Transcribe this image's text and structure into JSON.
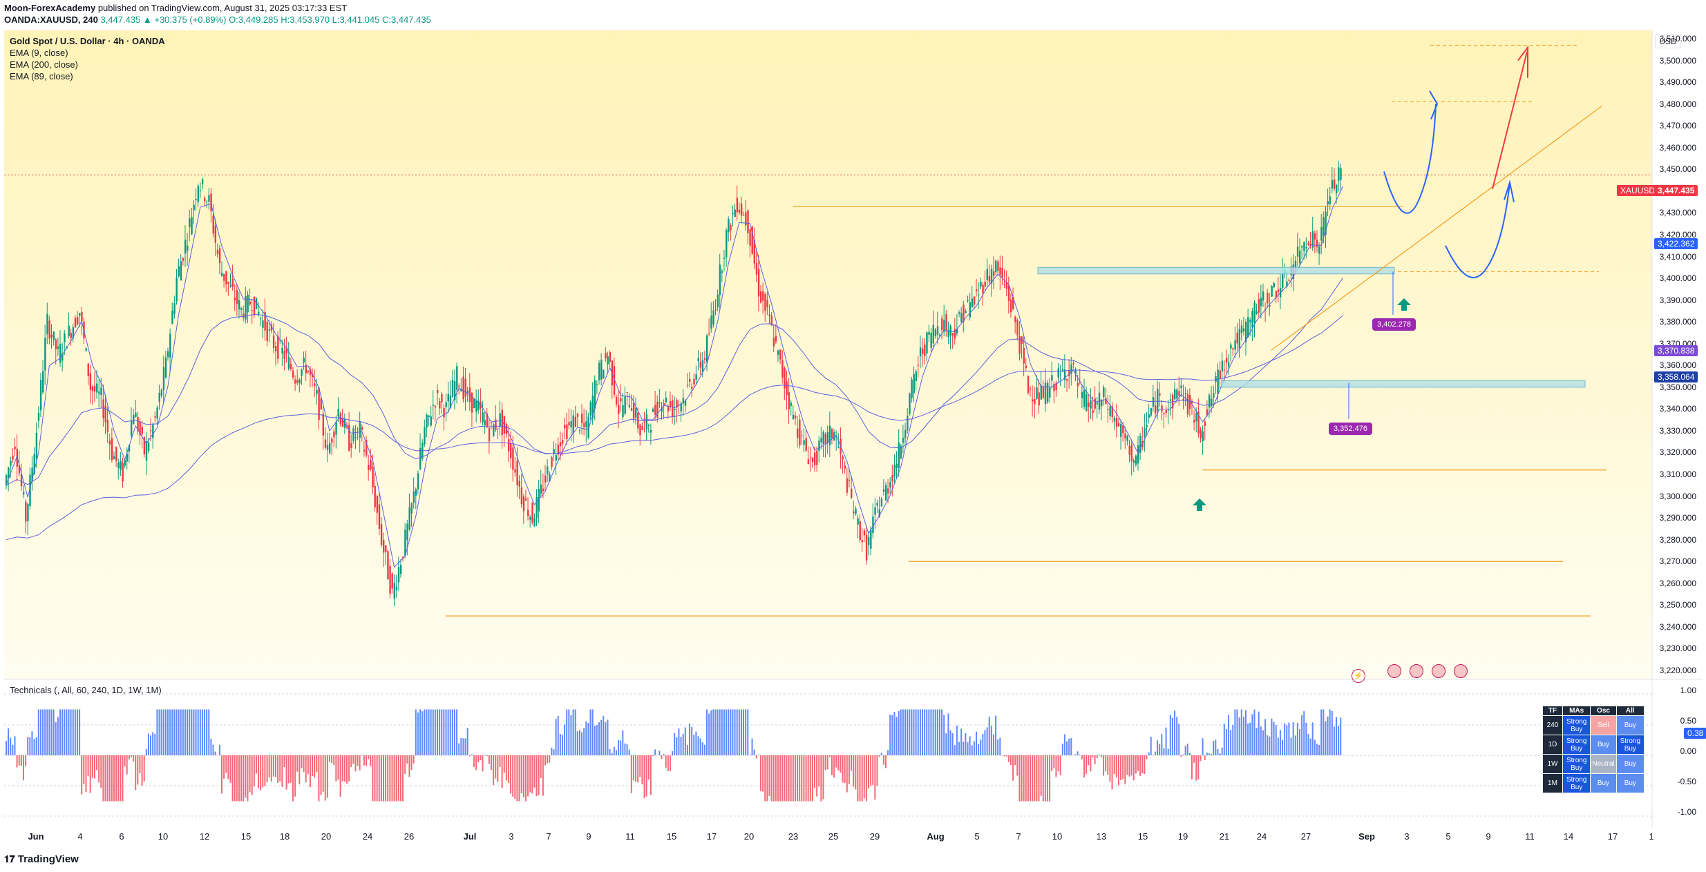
{
  "header": {
    "publisher": "Moon-ForexAcademy",
    "published_text": " published on TradingView.com, August 31, 2025 03:17:33 EST",
    "symbol": "OANDA:XAUUSD, 240",
    "change": "3,447.435 ▲ +30.375 (+0.89%)",
    "ohlc": "O:3,449.285  H:3,453.970  L:3,441.045  C:3,447.435"
  },
  "legend": {
    "title": "Gold Spot / U.S. Dollar · 4h · OANDA",
    "ema9": "EMA (9, close)",
    "ema200": "EMA (200, close)",
    "ema89": "EMA (89, close)"
  },
  "currency_button": "USD",
  "price_tags": {
    "symbol": "XAUUSD",
    "last": "3,447.435",
    "ema9": "3,422.362",
    "ema89": "3,370.838",
    "ema200": "3,358.064"
  },
  "annotations": {
    "label_1": "3,402.278",
    "label_2": "3,352.476"
  },
  "technicals": {
    "title": "Technicals (, All, 60, 240, 1D, 1W, 1M)",
    "value_tag": "0.38",
    "y_ticks": [
      "1.00",
      "0.50",
      "0.00",
      "-0.50",
      "-1.00"
    ],
    "table": {
      "headers": [
        "TF",
        "MAs",
        "Osc",
        "All"
      ],
      "rows": [
        [
          "240",
          "Strong Buy",
          "Sell",
          "Buy"
        ],
        [
          "1D",
          "Strong Buy",
          "Buy",
          "Strong Buy"
        ],
        [
          "1W",
          "Strong Buy",
          "Neutral",
          "Buy"
        ],
        [
          "1M",
          "Strong Buy",
          "Buy",
          "Buy"
        ]
      ]
    }
  },
  "footer_logo": "TradingView",
  "colors": {
    "bull": "#089981",
    "bear": "#f23645",
    "ema": "#5b5fe0",
    "orange": "#f59c1a",
    "blue_arrow": "#2962ff",
    "red_arrow": "#f23645",
    "zone": "#b2dfe6",
    "purple": "#9c27b0"
  },
  "chart_data": {
    "type": "candlestick",
    "symbol": "XAUUSD",
    "timeframe": "4h",
    "y_ticks": [
      3220,
      3230,
      3240,
      3250,
      3260,
      3270,
      3280,
      3290,
      3300,
      3310,
      3320,
      3330,
      3340,
      3350,
      3360,
      3370,
      3380,
      3390,
      3400,
      3410,
      3420,
      3430,
      3440,
      3450,
      3460,
      3470,
      3480,
      3490,
      3500,
      3510
    ],
    "y_tick_labels": [
      "3,220.000",
      "3,230.000",
      "3,240.000",
      "3,250.000",
      "3,260.000",
      "3,270.000",
      "3,280.000",
      "3,290.000",
      "3,300.000",
      "3,310.000",
      "3,320.000",
      "3,330.000",
      "3,340.000",
      "3,350.000",
      "3,360.000",
      "3,370.000",
      "3,380.000",
      "3,390.000",
      "3,400.000",
      "3,410.000",
      "3,420.000",
      "3,430.000",
      "3,440.000",
      "3,450.000",
      "3,460.000",
      "3,470.000",
      "3,480.000",
      "3,490.000",
      "3,500.000",
      "3,510.000"
    ],
    "x_labels": [
      "Jun",
      "4",
      "6",
      "10",
      "12",
      "15",
      "18",
      "20",
      "24",
      "26",
      "Jul",
      "3",
      "7",
      "9",
      "11",
      "15",
      "17",
      "20",
      "23",
      "25",
      "29",
      "Aug",
      "5",
      "7",
      "10",
      "13",
      "15",
      "19",
      "21",
      "24",
      "27",
      "Sep",
      "3",
      "5",
      "9",
      "11",
      "14",
      "17",
      "1"
    ],
    "price_path": [
      [
        0,
        3305
      ],
      [
        1,
        3325
      ],
      [
        2,
        3290
      ],
      [
        3,
        3330
      ],
      [
        4,
        3380
      ],
      [
        5,
        3365
      ],
      [
        6,
        3375
      ],
      [
        7,
        3385
      ],
      [
        8,
        3350
      ],
      [
        9,
        3345
      ],
      [
        10,
        3320
      ],
      [
        11,
        3310
      ],
      [
        12,
        3340
      ],
      [
        13,
        3320
      ],
      [
        14,
        3335
      ],
      [
        15,
        3360
      ],
      [
        16,
        3400
      ],
      [
        17,
        3420
      ],
      [
        18,
        3445
      ],
      [
        19,
        3435
      ],
      [
        20,
        3405
      ],
      [
        21,
        3395
      ],
      [
        22,
        3385
      ],
      [
        23,
        3390
      ],
      [
        24,
        3380
      ],
      [
        25,
        3370
      ],
      [
        26,
        3365
      ],
      [
        27,
        3355
      ],
      [
        28,
        3360
      ],
      [
        29,
        3345
      ],
      [
        30,
        3320
      ],
      [
        31,
        3340
      ],
      [
        32,
        3325
      ],
      [
        33,
        3330
      ],
      [
        34,
        3310
      ],
      [
        35,
        3280
      ],
      [
        36,
        3255
      ],
      [
        37,
        3275
      ],
      [
        38,
        3300
      ],
      [
        39,
        3330
      ],
      [
        40,
        3345
      ],
      [
        41,
        3340
      ],
      [
        42,
        3355
      ],
      [
        43,
        3345
      ],
      [
        44,
        3340
      ],
      [
        45,
        3330
      ],
      [
        46,
        3335
      ],
      [
        47,
        3320
      ],
      [
        48,
        3300
      ],
      [
        49,
        3290
      ],
      [
        50,
        3305
      ],
      [
        51,
        3320
      ],
      [
        52,
        3330
      ],
      [
        53,
        3335
      ],
      [
        54,
        3330
      ],
      [
        55,
        3355
      ],
      [
        56,
        3365
      ],
      [
        57,
        3340
      ],
      [
        58,
        3345
      ],
      [
        59,
        3330
      ],
      [
        60,
        3335
      ],
      [
        61,
        3345
      ],
      [
        62,
        3340
      ],
      [
        63,
        3345
      ],
      [
        64,
        3355
      ],
      [
        65,
        3365
      ],
      [
        66,
        3390
      ],
      [
        67,
        3420
      ],
      [
        68,
        3435
      ],
      [
        69,
        3425
      ],
      [
        70,
        3395
      ],
      [
        71,
        3380
      ],
      [
        72,
        3360
      ],
      [
        73,
        3340
      ],
      [
        74,
        3325
      ],
      [
        75,
        3315
      ],
      [
        76,
        3325
      ],
      [
        77,
        3330
      ],
      [
        78,
        3310
      ],
      [
        79,
        3290
      ],
      [
        80,
        3275
      ],
      [
        81,
        3295
      ],
      [
        82,
        3305
      ],
      [
        83,
        3320
      ],
      [
        84,
        3345
      ],
      [
        85,
        3365
      ],
      [
        86,
        3375
      ],
      [
        87,
        3380
      ],
      [
        88,
        3375
      ],
      [
        89,
        3385
      ],
      [
        90,
        3390
      ],
      [
        91,
        3400
      ],
      [
        92,
        3405
      ],
      [
        93,
        3395
      ],
      [
        94,
        3375
      ],
      [
        95,
        3350
      ],
      [
        96,
        3345
      ],
      [
        97,
        3350
      ],
      [
        98,
        3355
      ],
      [
        99,
        3360
      ],
      [
        100,
        3345
      ],
      [
        101,
        3340
      ],
      [
        102,
        3345
      ],
      [
        103,
        3335
      ],
      [
        104,
        3325
      ],
      [
        105,
        3315
      ],
      [
        106,
        3335
      ],
      [
        107,
        3345
      ],
      [
        108,
        3340
      ],
      [
        109,
        3350
      ],
      [
        110,
        3340
      ],
      [
        111,
        3330
      ],
      [
        112,
        3345
      ],
      [
        113,
        3360
      ],
      [
        114,
        3370
      ],
      [
        115,
        3375
      ],
      [
        116,
        3385
      ],
      [
        117,
        3390
      ],
      [
        118,
        3395
      ],
      [
        119,
        3400
      ],
      [
        120,
        3410
      ],
      [
        121,
        3420
      ],
      [
        122,
        3415
      ],
      [
        123,
        3440
      ],
      [
        124,
        3447.435
      ]
    ],
    "ema9": 3422.362,
    "ema89": 3370.838,
    "ema200": 3358.064,
    "horizontal_levels": [
      3447.435,
      3433,
      3402.278,
      3352.476,
      3312,
      3270,
      3245
    ],
    "projection_levels": [
      3507,
      3481,
      3403
    ],
    "demand_zones": [
      [
        3402,
        3405
      ],
      [
        3350,
        3353
      ]
    ]
  }
}
